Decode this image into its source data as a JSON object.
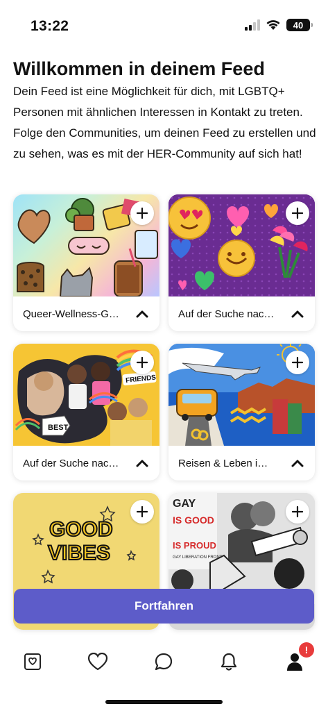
{
  "status": {
    "time": "13:22",
    "battery": "40"
  },
  "header": {
    "title": "Willkommen in deinem Feed",
    "intro": "Dein Feed ist eine Möglichkeit für dich, mit LGBTQ+ Personen mit ähnlichen Interessen in Kontakt zu treten. Folge den Communities, um deinen Feed zu erstellen und zu sehen, was es mit der HER-Community auf sich hat!"
  },
  "cards": [
    {
      "label": "Queer-Wellness-G…"
    },
    {
      "label": "Auf der Suche nac…"
    },
    {
      "label": "Auf der Suche nac…"
    },
    {
      "label": "Reisen & Leben i…"
    },
    {
      "label": ""
    },
    {
      "label": ""
    }
  ],
  "image_text": {
    "friends": "FRIENDS",
    "best": "BEST",
    "good": "GOOD",
    "vibes": "VIBES",
    "gay": "GAY",
    "is_good": "IS GOOD",
    "is_proud": "IS PROUD",
    "liberation": "GAY LIBERATION FRONT"
  },
  "cta": {
    "label": "Fortfahren"
  },
  "tabbar": {
    "badge": "!"
  },
  "colors": {
    "accent": "#5d5cc9",
    "badge": "#e83b3b"
  }
}
